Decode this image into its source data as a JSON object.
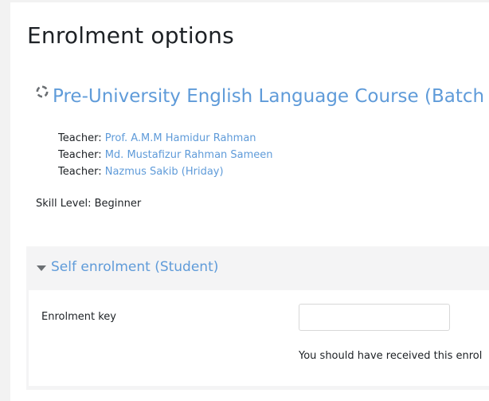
{
  "page": {
    "title": "Enrolment options",
    "skill_level": "Skill Level: Beginner"
  },
  "course": {
    "title": "Pre-University English Language Course (Batch",
    "icon": "course-icon",
    "teachers": [
      {
        "label": "Teacher: ",
        "name": "Prof. A.M.M Hamidur Rahman"
      },
      {
        "label": "Teacher: ",
        "name": "Md. Mustafizur Rahman Sameen"
      },
      {
        "label": "Teacher: ",
        "name": "Nazmus Sakib (Hriday)"
      }
    ]
  },
  "enrolment": {
    "section_title": "Self enrolment (Student)",
    "key_label": "Enrolment key",
    "key_value": "",
    "help_text": "You should have received this enrol"
  },
  "colors": {
    "link": "#5f9bd9",
    "section_bg": "#f4f4f5",
    "page_bg": "#f2f2f2"
  }
}
